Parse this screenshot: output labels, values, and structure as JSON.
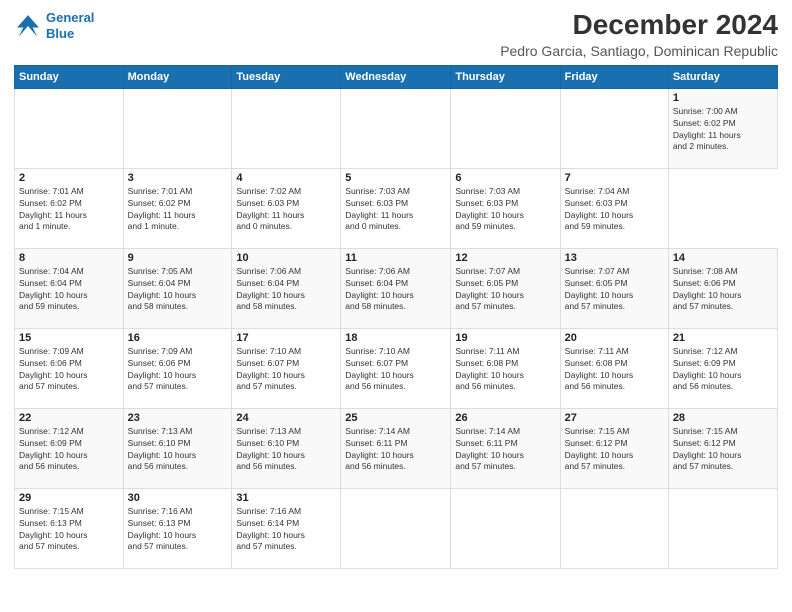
{
  "header": {
    "logo_line1": "General",
    "logo_line2": "Blue",
    "title": "December 2024",
    "subtitle": "Pedro Garcia, Santiago, Dominican Republic"
  },
  "calendar": {
    "days_of_week": [
      "Sunday",
      "Monday",
      "Tuesday",
      "Wednesday",
      "Thursday",
      "Friday",
      "Saturday"
    ],
    "weeks": [
      [
        {
          "day": "",
          "info": ""
        },
        {
          "day": "",
          "info": ""
        },
        {
          "day": "",
          "info": ""
        },
        {
          "day": "",
          "info": ""
        },
        {
          "day": "",
          "info": ""
        },
        {
          "day": "",
          "info": ""
        },
        {
          "day": "1",
          "info": "Sunrise: 7:00 AM\nSunset: 6:02 PM\nDaylight: 11 hours\nand 2 minutes."
        }
      ],
      [
        {
          "day": "2",
          "info": "Sunrise: 7:01 AM\nSunset: 6:02 PM\nDaylight: 11 hours\nand 1 minute."
        },
        {
          "day": "3",
          "info": "Sunrise: 7:01 AM\nSunset: 6:02 PM\nDaylight: 11 hours\nand 1 minute."
        },
        {
          "day": "4",
          "info": "Sunrise: 7:02 AM\nSunset: 6:03 PM\nDaylight: 11 hours\nand 0 minutes."
        },
        {
          "day": "5",
          "info": "Sunrise: 7:03 AM\nSunset: 6:03 PM\nDaylight: 11 hours\nand 0 minutes."
        },
        {
          "day": "6",
          "info": "Sunrise: 7:03 AM\nSunset: 6:03 PM\nDaylight: 10 hours\nand 59 minutes."
        },
        {
          "day": "7",
          "info": "Sunrise: 7:04 AM\nSunset: 6:03 PM\nDaylight: 10 hours\nand 59 minutes."
        }
      ],
      [
        {
          "day": "8",
          "info": "Sunrise: 7:04 AM\nSunset: 6:04 PM\nDaylight: 10 hours\nand 59 minutes."
        },
        {
          "day": "9",
          "info": "Sunrise: 7:05 AM\nSunset: 6:04 PM\nDaylight: 10 hours\nand 58 minutes."
        },
        {
          "day": "10",
          "info": "Sunrise: 7:06 AM\nSunset: 6:04 PM\nDaylight: 10 hours\nand 58 minutes."
        },
        {
          "day": "11",
          "info": "Sunrise: 7:06 AM\nSunset: 6:04 PM\nDaylight: 10 hours\nand 58 minutes."
        },
        {
          "day": "12",
          "info": "Sunrise: 7:07 AM\nSunset: 6:05 PM\nDaylight: 10 hours\nand 57 minutes."
        },
        {
          "day": "13",
          "info": "Sunrise: 7:07 AM\nSunset: 6:05 PM\nDaylight: 10 hours\nand 57 minutes."
        },
        {
          "day": "14",
          "info": "Sunrise: 7:08 AM\nSunset: 6:06 PM\nDaylight: 10 hours\nand 57 minutes."
        }
      ],
      [
        {
          "day": "15",
          "info": "Sunrise: 7:09 AM\nSunset: 6:06 PM\nDaylight: 10 hours\nand 57 minutes."
        },
        {
          "day": "16",
          "info": "Sunrise: 7:09 AM\nSunset: 6:06 PM\nDaylight: 10 hours\nand 57 minutes."
        },
        {
          "day": "17",
          "info": "Sunrise: 7:10 AM\nSunset: 6:07 PM\nDaylight: 10 hours\nand 57 minutes."
        },
        {
          "day": "18",
          "info": "Sunrise: 7:10 AM\nSunset: 6:07 PM\nDaylight: 10 hours\nand 56 minutes."
        },
        {
          "day": "19",
          "info": "Sunrise: 7:11 AM\nSunset: 6:08 PM\nDaylight: 10 hours\nand 56 minutes."
        },
        {
          "day": "20",
          "info": "Sunrise: 7:11 AM\nSunset: 6:08 PM\nDaylight: 10 hours\nand 56 minutes."
        },
        {
          "day": "21",
          "info": "Sunrise: 7:12 AM\nSunset: 6:09 PM\nDaylight: 10 hours\nand 56 minutes."
        }
      ],
      [
        {
          "day": "22",
          "info": "Sunrise: 7:12 AM\nSunset: 6:09 PM\nDaylight: 10 hours\nand 56 minutes."
        },
        {
          "day": "23",
          "info": "Sunrise: 7:13 AM\nSunset: 6:10 PM\nDaylight: 10 hours\nand 56 minutes."
        },
        {
          "day": "24",
          "info": "Sunrise: 7:13 AM\nSunset: 6:10 PM\nDaylight: 10 hours\nand 56 minutes."
        },
        {
          "day": "25",
          "info": "Sunrise: 7:14 AM\nSunset: 6:11 PM\nDaylight: 10 hours\nand 56 minutes."
        },
        {
          "day": "26",
          "info": "Sunrise: 7:14 AM\nSunset: 6:11 PM\nDaylight: 10 hours\nand 57 minutes."
        },
        {
          "day": "27",
          "info": "Sunrise: 7:15 AM\nSunset: 6:12 PM\nDaylight: 10 hours\nand 57 minutes."
        },
        {
          "day": "28",
          "info": "Sunrise: 7:15 AM\nSunset: 6:12 PM\nDaylight: 10 hours\nand 57 minutes."
        }
      ],
      [
        {
          "day": "29",
          "info": "Sunrise: 7:15 AM\nSunset: 6:13 PM\nDaylight: 10 hours\nand 57 minutes."
        },
        {
          "day": "30",
          "info": "Sunrise: 7:16 AM\nSunset: 6:13 PM\nDaylight: 10 hours\nand 57 minutes."
        },
        {
          "day": "31",
          "info": "Sunrise: 7:16 AM\nSunset: 6:14 PM\nDaylight: 10 hours\nand 57 minutes."
        },
        {
          "day": "",
          "info": ""
        },
        {
          "day": "",
          "info": ""
        },
        {
          "day": "",
          "info": ""
        },
        {
          "day": "",
          "info": ""
        }
      ]
    ]
  }
}
